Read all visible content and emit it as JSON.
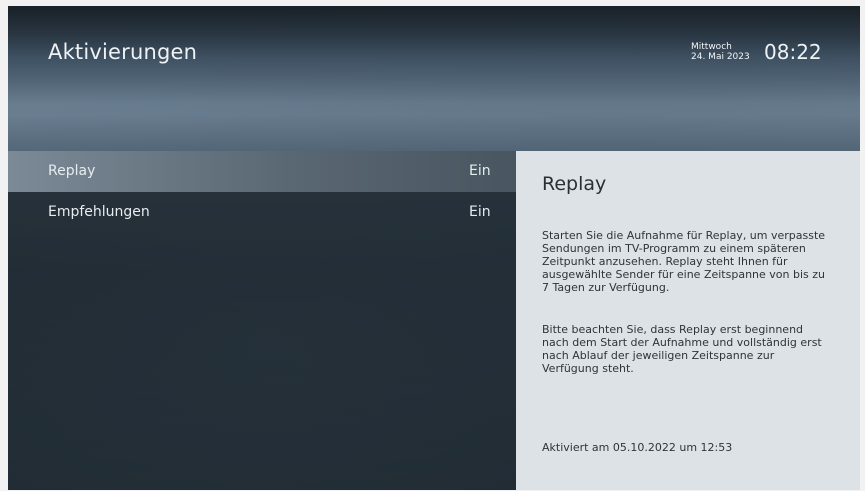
{
  "header": {
    "title": "Aktivierungen",
    "weekday": "Mittwoch",
    "date": "24. Mai 2023",
    "time": "08:22"
  },
  "menu": {
    "items": [
      {
        "label": "Replay",
        "value": "Ein",
        "selected": true
      },
      {
        "label": "Empfehlungen",
        "value": "Ein",
        "selected": false
      }
    ]
  },
  "details": {
    "title": "Replay",
    "paragraph1": "Starten Sie die Aufnahme für Replay, um verpasste Sendungen im TV-Programm zu einem späteren Zeitpunkt anzusehen. Replay steht Ihnen für ausgewählte Sender für eine Zeitspanne von bis zu 7 Tagen zur Verfügung.",
    "paragraph2": "Bitte beachten Sie, dass Replay erst beginnend nach dem Start der Aufnahme und vollständig erst nach Ablauf der jeweiligen Zeitspanne zur Verfügung steht.",
    "activated": "Aktiviert am 05.10.2022 um 12:53"
  },
  "colors": {
    "selected_item_bg": "#6b7985",
    "details_panel_bg": "#dde2e6"
  }
}
